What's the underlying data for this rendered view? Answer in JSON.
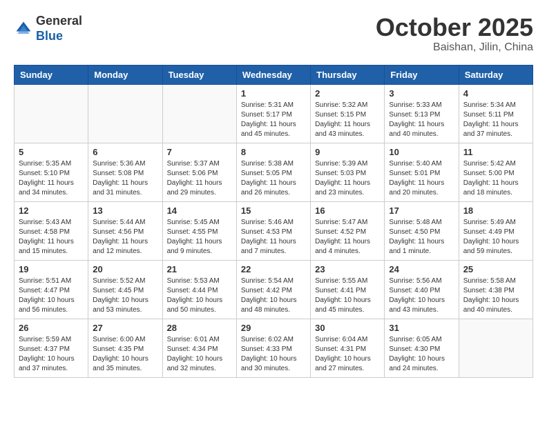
{
  "header": {
    "logo_general": "General",
    "logo_blue": "Blue",
    "month_title": "October 2025",
    "location": "Baishan, Jilin, China"
  },
  "weekdays": [
    "Sunday",
    "Monday",
    "Tuesday",
    "Wednesday",
    "Thursday",
    "Friday",
    "Saturday"
  ],
  "weeks": [
    [
      {
        "day": "",
        "info": ""
      },
      {
        "day": "",
        "info": ""
      },
      {
        "day": "",
        "info": ""
      },
      {
        "day": "1",
        "info": "Sunrise: 5:31 AM\nSunset: 5:17 PM\nDaylight: 11 hours\nand 45 minutes."
      },
      {
        "day": "2",
        "info": "Sunrise: 5:32 AM\nSunset: 5:15 PM\nDaylight: 11 hours\nand 43 minutes."
      },
      {
        "day": "3",
        "info": "Sunrise: 5:33 AM\nSunset: 5:13 PM\nDaylight: 11 hours\nand 40 minutes."
      },
      {
        "day": "4",
        "info": "Sunrise: 5:34 AM\nSunset: 5:11 PM\nDaylight: 11 hours\nand 37 minutes."
      }
    ],
    [
      {
        "day": "5",
        "info": "Sunrise: 5:35 AM\nSunset: 5:10 PM\nDaylight: 11 hours\nand 34 minutes."
      },
      {
        "day": "6",
        "info": "Sunrise: 5:36 AM\nSunset: 5:08 PM\nDaylight: 11 hours\nand 31 minutes."
      },
      {
        "day": "7",
        "info": "Sunrise: 5:37 AM\nSunset: 5:06 PM\nDaylight: 11 hours\nand 29 minutes."
      },
      {
        "day": "8",
        "info": "Sunrise: 5:38 AM\nSunset: 5:05 PM\nDaylight: 11 hours\nand 26 minutes."
      },
      {
        "day": "9",
        "info": "Sunrise: 5:39 AM\nSunset: 5:03 PM\nDaylight: 11 hours\nand 23 minutes."
      },
      {
        "day": "10",
        "info": "Sunrise: 5:40 AM\nSunset: 5:01 PM\nDaylight: 11 hours\nand 20 minutes."
      },
      {
        "day": "11",
        "info": "Sunrise: 5:42 AM\nSunset: 5:00 PM\nDaylight: 11 hours\nand 18 minutes."
      }
    ],
    [
      {
        "day": "12",
        "info": "Sunrise: 5:43 AM\nSunset: 4:58 PM\nDaylight: 11 hours\nand 15 minutes."
      },
      {
        "day": "13",
        "info": "Sunrise: 5:44 AM\nSunset: 4:56 PM\nDaylight: 11 hours\nand 12 minutes."
      },
      {
        "day": "14",
        "info": "Sunrise: 5:45 AM\nSunset: 4:55 PM\nDaylight: 11 hours\nand 9 minutes."
      },
      {
        "day": "15",
        "info": "Sunrise: 5:46 AM\nSunset: 4:53 PM\nDaylight: 11 hours\nand 7 minutes."
      },
      {
        "day": "16",
        "info": "Sunrise: 5:47 AM\nSunset: 4:52 PM\nDaylight: 11 hours\nand 4 minutes."
      },
      {
        "day": "17",
        "info": "Sunrise: 5:48 AM\nSunset: 4:50 PM\nDaylight: 11 hours\nand 1 minute."
      },
      {
        "day": "18",
        "info": "Sunrise: 5:49 AM\nSunset: 4:49 PM\nDaylight: 10 hours\nand 59 minutes."
      }
    ],
    [
      {
        "day": "19",
        "info": "Sunrise: 5:51 AM\nSunset: 4:47 PM\nDaylight: 10 hours\nand 56 minutes."
      },
      {
        "day": "20",
        "info": "Sunrise: 5:52 AM\nSunset: 4:45 PM\nDaylight: 10 hours\nand 53 minutes."
      },
      {
        "day": "21",
        "info": "Sunrise: 5:53 AM\nSunset: 4:44 PM\nDaylight: 10 hours\nand 50 minutes."
      },
      {
        "day": "22",
        "info": "Sunrise: 5:54 AM\nSunset: 4:42 PM\nDaylight: 10 hours\nand 48 minutes."
      },
      {
        "day": "23",
        "info": "Sunrise: 5:55 AM\nSunset: 4:41 PM\nDaylight: 10 hours\nand 45 minutes."
      },
      {
        "day": "24",
        "info": "Sunrise: 5:56 AM\nSunset: 4:40 PM\nDaylight: 10 hours\nand 43 minutes."
      },
      {
        "day": "25",
        "info": "Sunrise: 5:58 AM\nSunset: 4:38 PM\nDaylight: 10 hours\nand 40 minutes."
      }
    ],
    [
      {
        "day": "26",
        "info": "Sunrise: 5:59 AM\nSunset: 4:37 PM\nDaylight: 10 hours\nand 37 minutes."
      },
      {
        "day": "27",
        "info": "Sunrise: 6:00 AM\nSunset: 4:35 PM\nDaylight: 10 hours\nand 35 minutes."
      },
      {
        "day": "28",
        "info": "Sunrise: 6:01 AM\nSunset: 4:34 PM\nDaylight: 10 hours\nand 32 minutes."
      },
      {
        "day": "29",
        "info": "Sunrise: 6:02 AM\nSunset: 4:33 PM\nDaylight: 10 hours\nand 30 minutes."
      },
      {
        "day": "30",
        "info": "Sunrise: 6:04 AM\nSunset: 4:31 PM\nDaylight: 10 hours\nand 27 minutes."
      },
      {
        "day": "31",
        "info": "Sunrise: 6:05 AM\nSunset: 4:30 PM\nDaylight: 10 hours\nand 24 minutes."
      },
      {
        "day": "",
        "info": ""
      }
    ]
  ]
}
